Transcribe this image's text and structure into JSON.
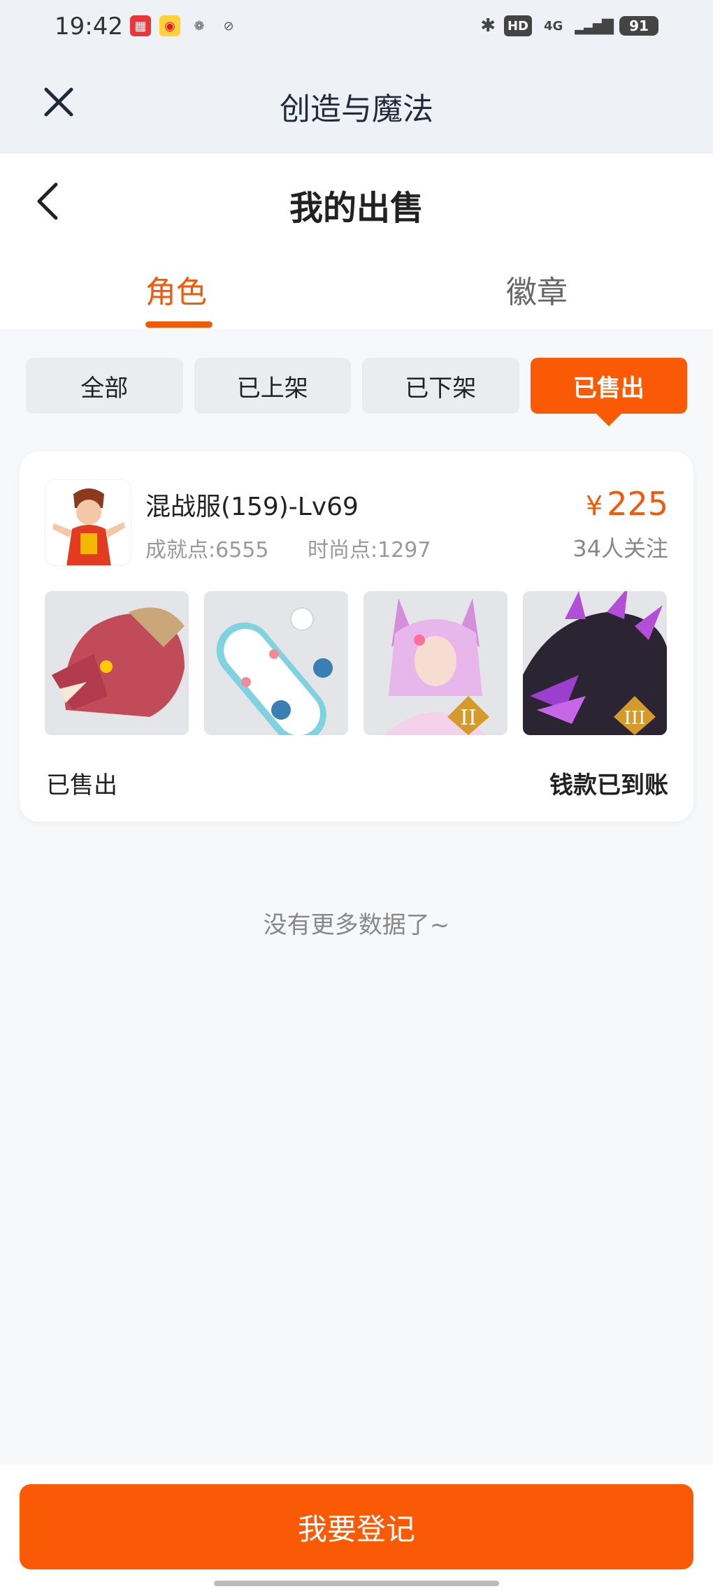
{
  "status_bar": {
    "time": "19:42",
    "apps": [
      "app-icon-red",
      "weibo-icon",
      "wechat-icon",
      "compass-icon"
    ],
    "network_badge": "HD",
    "signal_label": "4G",
    "battery": "91"
  },
  "top_bar": {
    "title": "创造与魔法"
  },
  "header": {
    "title": "我的出售",
    "tabs": [
      {
        "label": "角色",
        "active": true
      },
      {
        "label": "徽章",
        "active": false
      }
    ]
  },
  "filters": [
    {
      "label": "全部",
      "active": false
    },
    {
      "label": "已上架",
      "active": false
    },
    {
      "label": "已下架",
      "active": false
    },
    {
      "label": "已售出",
      "active": true
    }
  ],
  "card": {
    "name": "混战服(159)-Lv69",
    "achievement_points": "成就点:6555",
    "fashion_points": "时尚点:1297",
    "price_symbol": "¥",
    "price": "225",
    "followers": "34人关注",
    "thumbnails": [
      "dragon-head-mount",
      "bear-skateboard",
      "fox-spirit-rank-ii",
      "dark-dragon-rank-iii"
    ],
    "status_left": "已售出",
    "status_right": "钱款已到账"
  },
  "list_end_text": "没有更多数据了~",
  "bottom_button": "我要登记",
  "colors": {
    "accent": "#fa5a05",
    "accent_text": "#f05a08"
  }
}
